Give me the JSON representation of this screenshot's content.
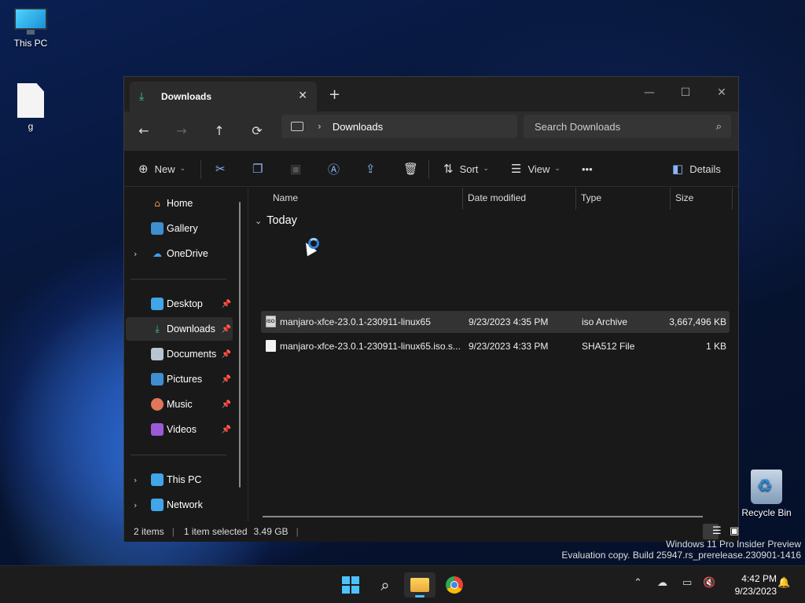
{
  "desktop": {
    "icons": [
      {
        "label": "This PC",
        "icon": "monitor-icon"
      },
      {
        "label": "g",
        "icon": "file-icon"
      },
      {
        "label": "Recycle Bin",
        "icon": "recycle-bin-icon"
      }
    ],
    "watermark": {
      "line1": "Windows 11 Pro Insider Preview",
      "line2": "Evaluation copy. Build 25947.rs_prerelease.230901-1416"
    }
  },
  "explorer": {
    "tab": {
      "title": "Downloads",
      "icon": "download-icon"
    },
    "navbar": {
      "address": "Downloads",
      "search_placeholder": "Search Downloads"
    },
    "toolbar": {
      "new_label": "New",
      "sort_label": "Sort",
      "view_label": "View",
      "more_label": "•••",
      "details_label": "Details"
    },
    "sidebar": {
      "items": [
        {
          "label": "Home",
          "icon": "home-icon"
        },
        {
          "label": "Gallery",
          "icon": "gallery-icon"
        },
        {
          "label": "OneDrive",
          "icon": "onedrive-icon"
        },
        {
          "label": "Desktop",
          "icon": "desktop-icon"
        },
        {
          "label": "Downloads",
          "icon": "download-icon"
        },
        {
          "label": "Documents",
          "icon": "documents-icon"
        },
        {
          "label": "Pictures",
          "icon": "pictures-icon"
        },
        {
          "label": "Music",
          "icon": "music-icon"
        },
        {
          "label": "Videos",
          "icon": "videos-icon"
        },
        {
          "label": "This PC",
          "icon": "monitor-icon"
        },
        {
          "label": "Network",
          "icon": "network-icon"
        }
      ]
    },
    "columns": {
      "name": "Name",
      "date": "Date modified",
      "type": "Type",
      "size": "Size"
    },
    "group": "Today",
    "files": [
      {
        "name": "manjaro-xfce-23.0.1-230911-linux65",
        "date": "9/23/2023 4:35 PM",
        "type": "iso Archive",
        "size": "3,667,496 KB",
        "selected": true
      },
      {
        "name": "manjaro-xfce-23.0.1-230911-linux65.iso.s...",
        "date": "9/23/2023 4:33 PM",
        "type": "SHA512 File",
        "size": "1 KB",
        "selected": false
      }
    ],
    "status": {
      "items": "2 items",
      "selected": "1 item selected",
      "size": "3.49 GB"
    }
  },
  "taskbar": {
    "time": "4:42 PM",
    "date": "9/23/2023"
  }
}
